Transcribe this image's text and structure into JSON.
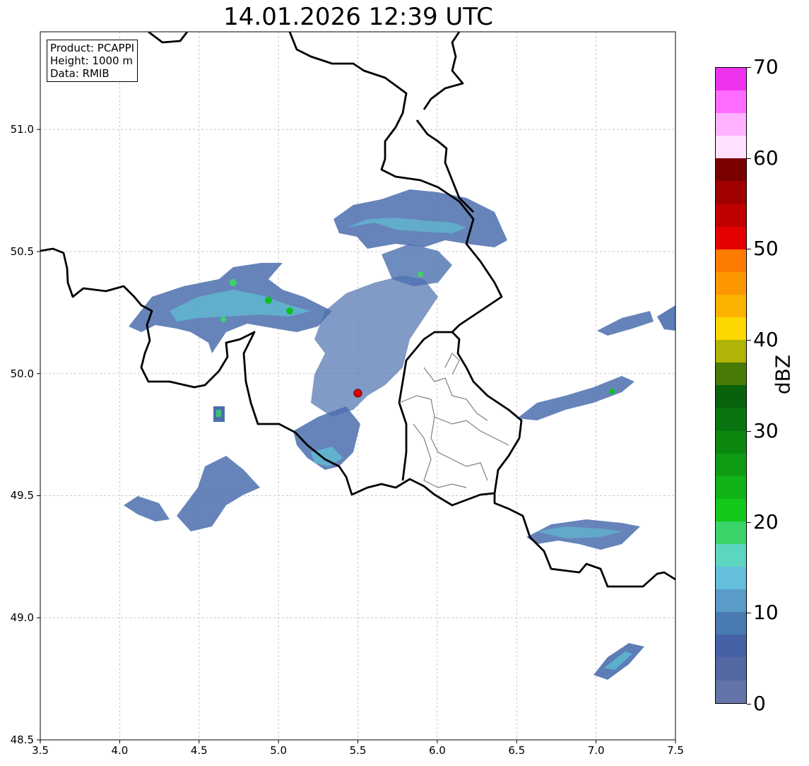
{
  "title": "14.01.2026 12:39 UTC",
  "info": {
    "product": "Product: PCAPPI",
    "height": "Height: 1000 m",
    "source": "Data: RMIB"
  },
  "map": {
    "lon_range": [
      3.5,
      7.5
    ],
    "lat_range": [
      48.5,
      51.4
    ],
    "x_ticks": [
      "3.5",
      "4.0",
      "4.5",
      "5.0",
      "5.5",
      "6.0",
      "6.5",
      "7.0",
      "7.5"
    ],
    "y_ticks": [
      "48.5",
      "49.0",
      "49.5",
      "50.0",
      "50.5",
      "51.0"
    ],
    "grid": true,
    "radar_site": {
      "lon": 5.5,
      "lat": 49.92,
      "color": "#e00000"
    },
    "echo_colors": {
      "weak": "#4b6fae",
      "moderate": "#5ec6d6",
      "strong": "#10c020"
    }
  },
  "colorbar": {
    "label": "dBZ",
    "range": [
      0,
      70
    ],
    "ticks": [
      "0",
      "10",
      "20",
      "30",
      "40",
      "50",
      "60",
      "70"
    ],
    "colors": [
      "#6374a8",
      "#5469a2",
      "#4562a6",
      "#4a7ab2",
      "#5a9cc8",
      "#64bedc",
      "#5dd6c0",
      "#3ad46a",
      "#12c818",
      "#10b418",
      "#0f9c14",
      "#0c880f",
      "#097410",
      "#07620b",
      "#4a7a08",
      "#afb406",
      "#fcd700",
      "#fcb300",
      "#fc9700",
      "#fc7b00",
      "#e40000",
      "#c00000",
      "#a00000",
      "#7a0000",
      "#ffe0ff",
      "#ffb2ff",
      "#ff6cff",
      "#ee32ee"
    ]
  }
}
